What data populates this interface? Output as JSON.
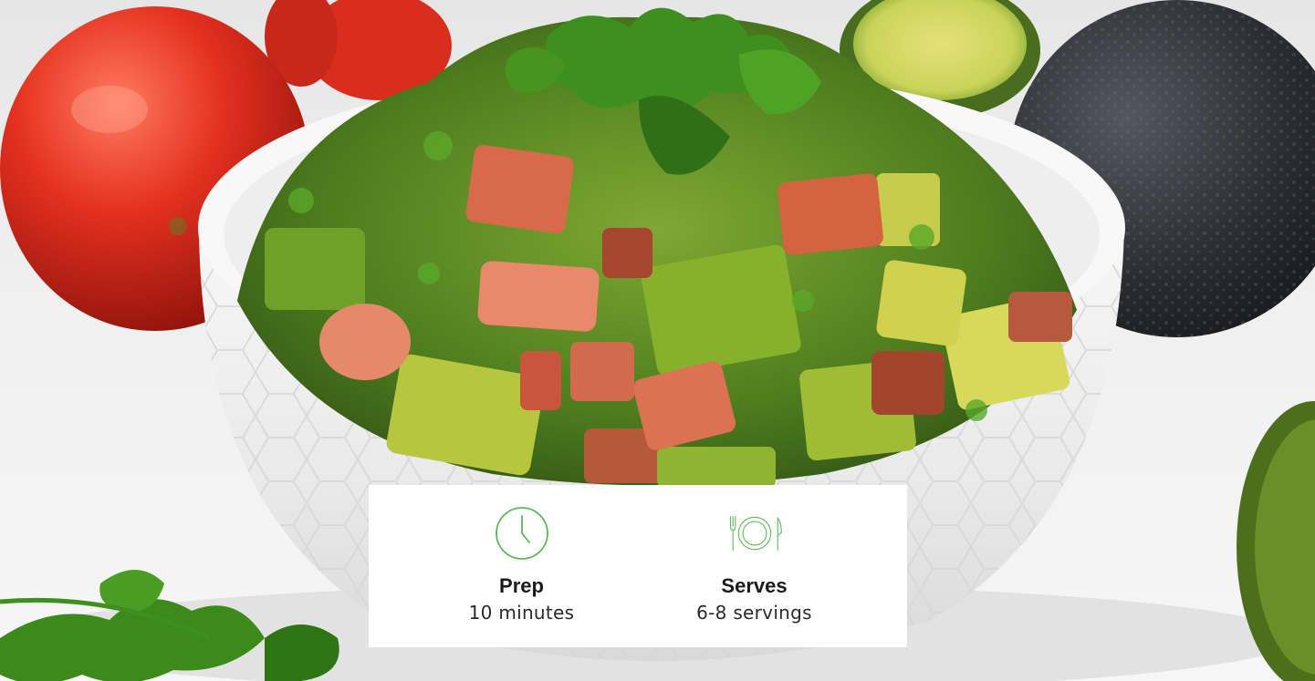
{
  "hero": {
    "image_alt_icon": "salsa-bowl-photo",
    "accent_color": "#5cb85c"
  },
  "recipe_info": {
    "prep": {
      "icon": "clock-icon",
      "label": "Prep",
      "value": "10 minutes"
    },
    "serves": {
      "icon": "plate-cutlery-icon",
      "label": "Serves",
      "value": "6-8 servings"
    }
  }
}
